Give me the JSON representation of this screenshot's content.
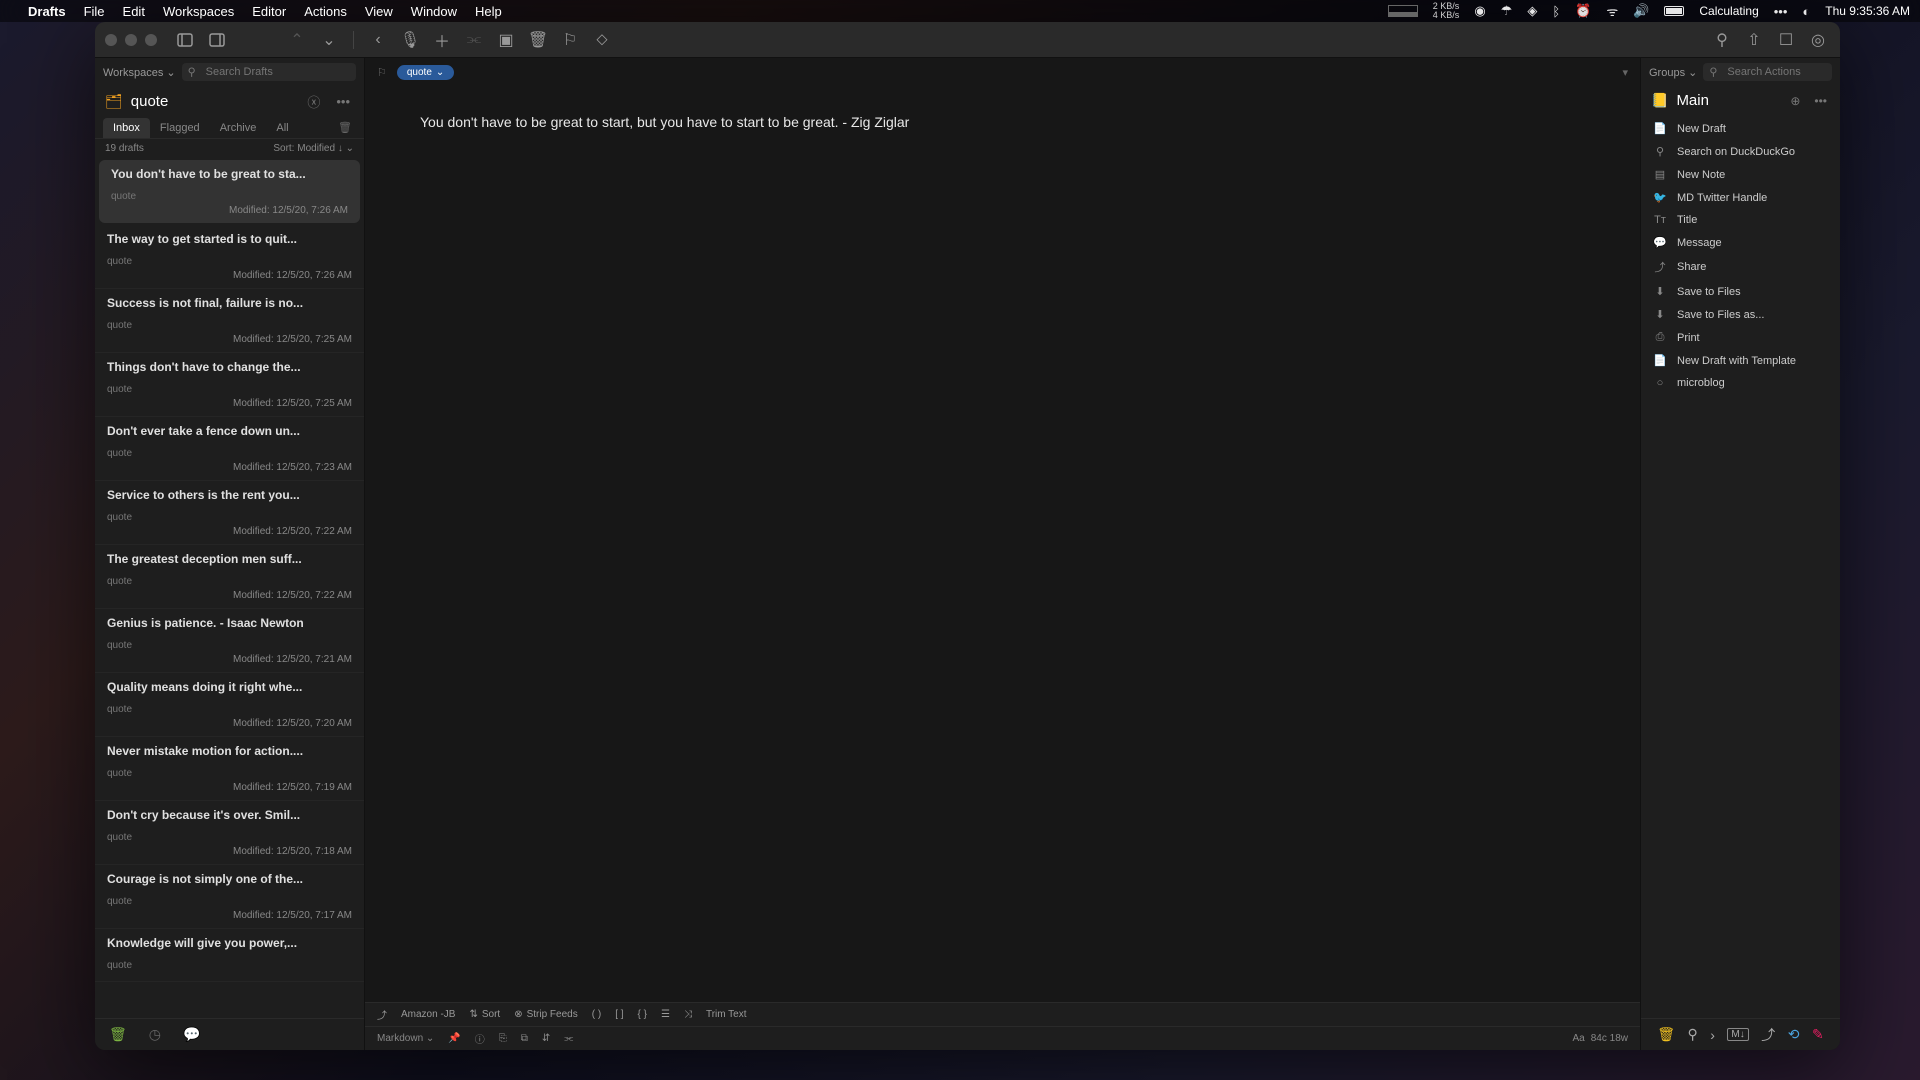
{
  "menubar": {
    "app": "Drafts",
    "items": [
      "File",
      "Edit",
      "Workspaces",
      "Editor",
      "Actions",
      "View",
      "Window",
      "Help"
    ],
    "net_up": "2 KB/s",
    "net_dn": "4 KB/s",
    "status": "Calculating",
    "clock": "Thu  9:35:36 AM"
  },
  "left_panel": {
    "workspaces_label": "Workspaces",
    "search_placeholder": "Search Drafts",
    "title": "quote",
    "tabs": [
      "Inbox",
      "Flagged",
      "Archive",
      "All"
    ],
    "active_tab": 0,
    "count_label": "19 drafts",
    "sort_label": "Sort: Modified ↓",
    "drafts": [
      {
        "title": "You don't have to be great to sta...",
        "tag": "quote",
        "modified": "Modified: 12/5/20, 7:26 AM"
      },
      {
        "title": "The way to get started is to quit...",
        "tag": "quote",
        "modified": "Modified: 12/5/20, 7:26 AM"
      },
      {
        "title": "Success is not final, failure is no...",
        "tag": "quote",
        "modified": "Modified: 12/5/20, 7:25 AM"
      },
      {
        "title": "Things don't have to change the...",
        "tag": "quote",
        "modified": "Modified: 12/5/20, 7:25 AM"
      },
      {
        "title": "Don't ever take a fence down un...",
        "tag": "quote",
        "modified": "Modified: 12/5/20, 7:23 AM"
      },
      {
        "title": "Service to others is the rent you...",
        "tag": "quote",
        "modified": "Modified: 12/5/20, 7:22 AM"
      },
      {
        "title": "The greatest deception men suff...",
        "tag": "quote",
        "modified": "Modified: 12/5/20, 7:22 AM"
      },
      {
        "title": "Genius is patience. - Isaac Newton",
        "tag": "quote",
        "modified": "Modified: 12/5/20, 7:21 AM"
      },
      {
        "title": "Quality means doing it right whe...",
        "tag": "quote",
        "modified": "Modified: 12/5/20, 7:20 AM"
      },
      {
        "title": "Never mistake motion for action....",
        "tag": "quote",
        "modified": "Modified: 12/5/20, 7:19 AM"
      },
      {
        "title": "Don't cry because it's over. Smil...",
        "tag": "quote",
        "modified": "Modified: 12/5/20, 7:18 AM"
      },
      {
        "title": "Courage is not simply one of the...",
        "tag": "quote",
        "modified": "Modified: 12/5/20, 7:17 AM"
      },
      {
        "title": "Knowledge will give you power,...",
        "tag": "quote",
        "modified": ""
      }
    ]
  },
  "editor": {
    "tag": "quote",
    "content": "You don't have to be great to start, but you have to start to be great. - Zig Ziglar",
    "actionbar": {
      "amazon": "Amazon -JB",
      "sort": "Sort",
      "strip": "Strip Feeds",
      "trim": "Trim Text"
    },
    "syntax": "Markdown",
    "stats": "84c 18w",
    "font_label": "Aa"
  },
  "right_panel": {
    "groups_label": "Groups",
    "search_placeholder": "Search Actions",
    "title": "Main",
    "actions": [
      {
        "icon": "doc",
        "label": "New Draft"
      },
      {
        "icon": "search",
        "label": "Search on DuckDuckGo"
      },
      {
        "icon": "note",
        "label": "New Note"
      },
      {
        "icon": "twitter",
        "label": "MD Twitter Handle"
      },
      {
        "icon": "title",
        "label": "Title"
      },
      {
        "icon": "message",
        "label": "Message",
        "green": true
      },
      {
        "icon": "share",
        "label": "Share"
      },
      {
        "icon": "save",
        "label": "Save to Files"
      },
      {
        "icon": "saveas",
        "label": "Save to Files as..."
      },
      {
        "icon": "print",
        "label": "Print"
      },
      {
        "icon": "template",
        "label": "New Draft with Template"
      },
      {
        "icon": "circle",
        "label": "microblog"
      }
    ]
  }
}
